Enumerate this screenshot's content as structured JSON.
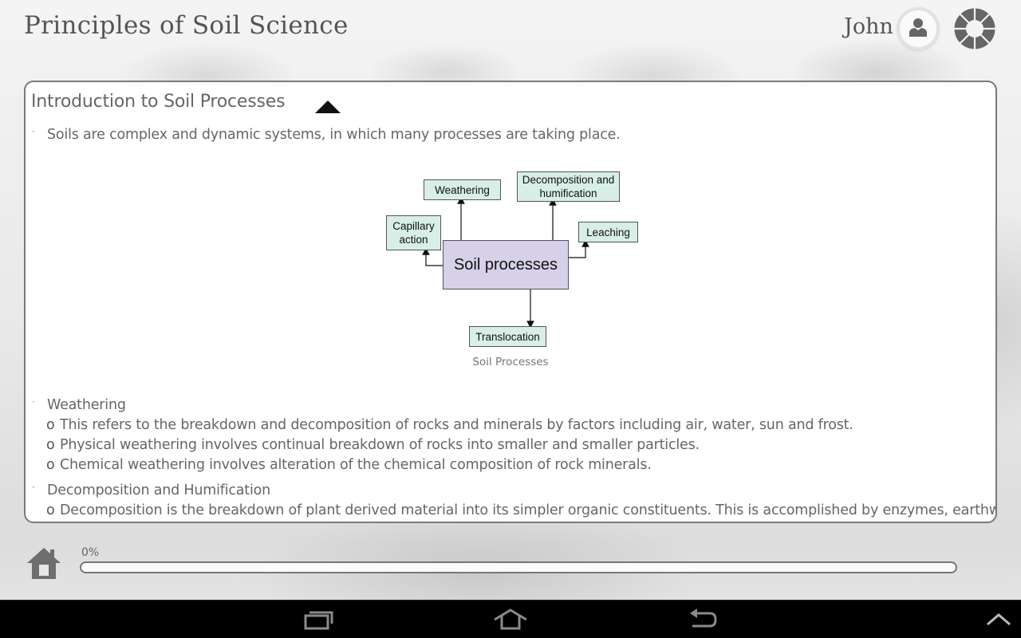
{
  "header": {
    "app_title": "Principles of Soil Science",
    "user_name": "John",
    "icons": {
      "user": "user-silhouette-icon",
      "settings": "segmented-ring-icon"
    }
  },
  "lesson": {
    "section_title": "Introduction to Soil Processes",
    "toggle_icon": "triangle-up-icon",
    "intro_bullet": "Soils are complex and dynamic systems, in which many processes are taking place.",
    "figure": {
      "center": "Soil processes",
      "nodes": {
        "capillary": "Capillary action",
        "weathering": "Weathering",
        "decomposition": "Decomposition and humification",
        "leaching": "Leaching",
        "translocation": "Translocation"
      },
      "caption": "Soil Processes",
      "colors": {
        "node_fill": "#d7efe6",
        "center_fill": "#d6d0e8"
      }
    },
    "sections": [
      {
        "heading": "Weathering",
        "items": [
          "This refers to the breakdown and decomposition of rocks and minerals by factors including air, water, sun and frost.",
          "Physical weathering involves continual breakdown of rocks into smaller and smaller particles.",
          "Chemical weathering involves alteration of the chemical composition of rock minerals."
        ]
      },
      {
        "heading": "Decomposition and Humification",
        "items": [
          "Decomposition is the breakdown of plant derived material into its simpler organic constituents. This is accomplished by enzymes, earthworms, mites"
        ]
      }
    ],
    "bullet_marker": "·",
    "sub_marker": "o"
  },
  "footer": {
    "home_icon": "home-icon",
    "progress_label": "0%",
    "progress_value": 0
  },
  "nav_bar": {
    "recent_apps": "recent-apps-icon",
    "home": "android-home-icon",
    "back": "back-icon",
    "menu": "chevron-up-icon"
  }
}
